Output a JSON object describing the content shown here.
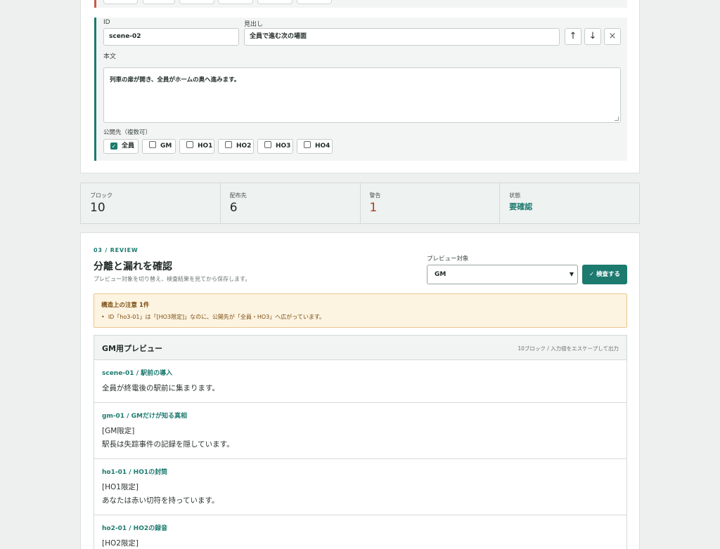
{
  "editor": {
    "block": {
      "id_label": "ID",
      "id_value": "scene-02",
      "heading_label": "見出し",
      "heading_value": "全員で進む次の場面",
      "body_label": "本文",
      "body_value": "列車の扉が開き、全員がホームの奥へ進みます。",
      "audience_label": "公開先（複数可）",
      "move_up_icon": "↑",
      "move_down_icon": "↓",
      "remove_icon": "×",
      "audiences": [
        {
          "label": "全員",
          "checked": true
        },
        {
          "label": "GM",
          "checked": false
        },
        {
          "label": "HO1",
          "checked": false
        },
        {
          "label": "HO2",
          "checked": false
        },
        {
          "label": "HO3",
          "checked": false
        },
        {
          "label": "HO4",
          "checked": false
        }
      ]
    }
  },
  "stats": [
    {
      "label": "ブロック",
      "value": "10"
    },
    {
      "label": "配布先",
      "value": "6"
    },
    {
      "label": "警告",
      "value": "1"
    },
    {
      "label": "状態",
      "value": "要確認"
    }
  ],
  "review": {
    "kicker": "03 / REVIEW",
    "title": "分離と漏れを確認",
    "subtitle": "プレビュー対象を切り替え、検査結果を見てから保存します。",
    "select_label": "プレビュー対象",
    "select_value": "GM",
    "check_button": "✓ 検査する",
    "alert_title": "構造上の注意 1件",
    "alert_item": "ID「ho3-01」は「[HO3限定]」なのに、公開先が「全員・HO3」へ広がっています。",
    "preview_title": "GM用プレビュー",
    "preview_meta": "10ブロック / 入力値をエスケープして出力",
    "items": [
      {
        "id": "scene-01 / 駅前の導入",
        "line1": "全員が終電後の駅前に集まります。",
        "line2": ""
      },
      {
        "id": "gm-01 / GMだけが知る真相",
        "line1": "[GM限定]",
        "line2": "駅長は失踪事件の記録を隠しています。"
      },
      {
        "id": "ho1-01 / HO1の封筒",
        "line1": "[HO1限定]",
        "line2": "あなたは赤い切符を持っています。"
      },
      {
        "id": "ho2-01 / HO2の録音",
        "line1": "[HO2限定]",
        "line2": ""
      }
    ]
  },
  "colors": {
    "accent": "#1c7a6f",
    "warning": "#b2372a",
    "alert_bg": "#fdf3e1"
  }
}
